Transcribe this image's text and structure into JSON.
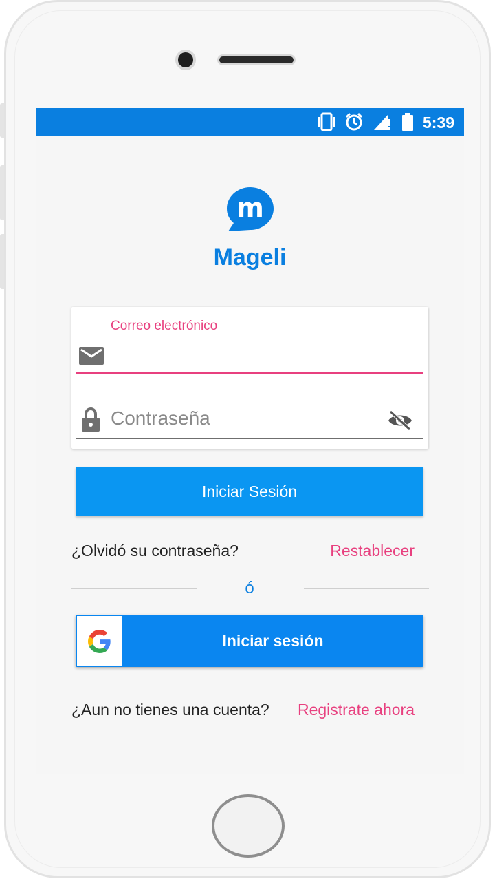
{
  "status_bar": {
    "time": "5:39",
    "icons": [
      "vibrate-icon",
      "alarm-icon",
      "signal-icon",
      "battery-icon"
    ]
  },
  "app": {
    "name": "Mageli",
    "logo_letter": "m"
  },
  "login_form": {
    "email": {
      "label": "Correo electrónico",
      "value": ""
    },
    "password": {
      "placeholder": "Contraseña",
      "value": ""
    }
  },
  "buttons": {
    "login": "Iniciar Sesión",
    "google_login": "Iniciar sesión"
  },
  "forgot": {
    "question": "¿Olvidó su contraseña?",
    "action": "Restablecer"
  },
  "separator": "ó",
  "register": {
    "question": "¿Aun no tienes una cuenta?",
    "action": "Registrate ahora"
  },
  "colors": {
    "primary": "#0a7fe0",
    "accent": "#e8407f",
    "button": "#0a96f2"
  }
}
